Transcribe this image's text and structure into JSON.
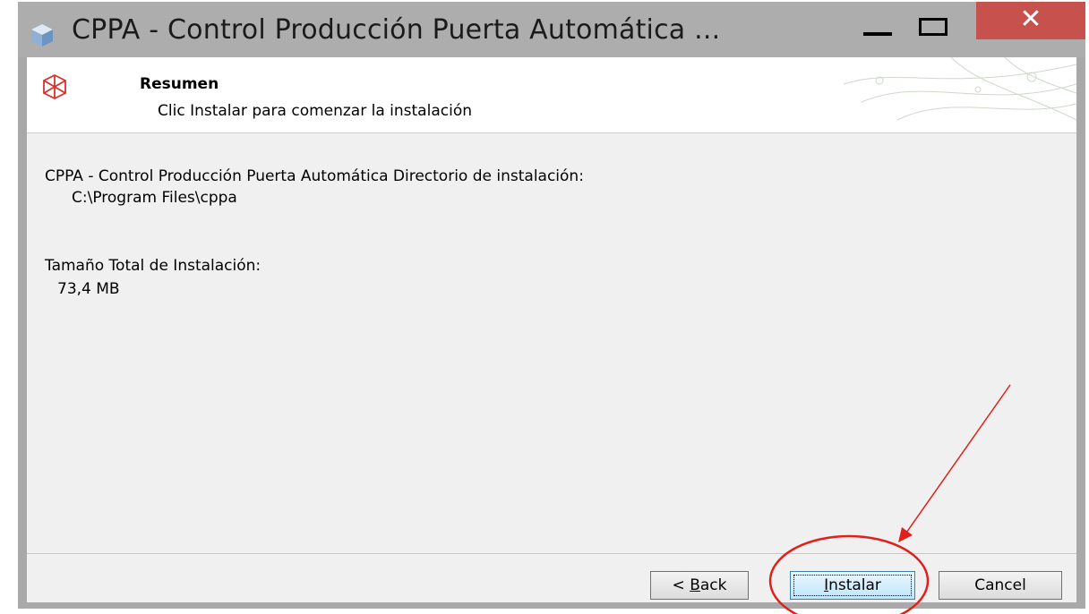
{
  "window": {
    "title": "CPPA - Control Producción Puerta Automática ...",
    "close_glyph": "✕",
    "icons": {
      "app": "app-cube-icon",
      "minimize": "minimize-icon",
      "maximize": "maximize-icon",
      "close": "close-icon"
    },
    "colors": {
      "titlebar": "#adadad",
      "close_button": "#c7514c"
    }
  },
  "header": {
    "title": "Resumen",
    "subtitle": "Clic Instalar para comenzar la instalación",
    "icon": "installer-cube-icon"
  },
  "summary": {
    "product_line": "CPPA - Control Producción Puerta Automática Directorio de instalación:",
    "install_dir": "C:\\Program Files\\cppa",
    "size_label": "Tamaño Total de Instalación:",
    "size_value": "73,4 MB"
  },
  "buttons": {
    "back_prefix": "< ",
    "back_key": "B",
    "back_rest": "ack",
    "install_key": "I",
    "install_rest": "nstalar",
    "cancel": "Cancel"
  },
  "annotation": {
    "color": "#e0201b",
    "shapes": [
      "arrow",
      "circle"
    ]
  }
}
